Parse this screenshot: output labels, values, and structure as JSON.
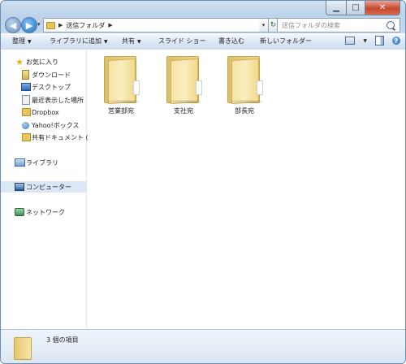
{
  "window": {
    "controls": {
      "minimize": "▁",
      "maximize": "□",
      "close": "✕"
    }
  },
  "nav": {
    "back_icon": "◀",
    "forward_icon": "▶",
    "dropdown_icon": "▾",
    "breadcrumb": [
      "送信フォルダ"
    ],
    "address_dropdown": "▾",
    "refresh_icon": "↻",
    "search_placeholder": "送信フォルダの検索"
  },
  "toolbar": {
    "items": [
      {
        "label": "整理",
        "caret": "▼"
      },
      {
        "label": "ライブラリに追加",
        "caret": "▼"
      },
      {
        "label": "共有",
        "caret": "▼"
      },
      {
        "label": "スライド ショー",
        "caret": ""
      },
      {
        "label": "書き込む",
        "caret": ""
      },
      {
        "label": "新しいフォルダー",
        "caret": ""
      }
    ],
    "view_caret": "▼",
    "help_icon": "?"
  },
  "sidebar": {
    "favorites": {
      "label": "お気に入り",
      "items": [
        {
          "label": "ダウンロード",
          "icon": "download-icon"
        },
        {
          "label": "デスクトップ",
          "icon": "desktop-icon"
        },
        {
          "label": "最近表示した場所",
          "icon": "recent-places-icon"
        },
        {
          "label": "Dropbox",
          "icon": "folder-icon"
        },
        {
          "label": "Yahoo!ボックス",
          "icon": "yahoo-box-icon"
        },
        {
          "label": "共有ドキュメント (",
          "icon": "shared-folder-icon"
        }
      ]
    },
    "library": {
      "label": "ライブラリ"
    },
    "computer": {
      "label": "コンピューター"
    },
    "network": {
      "label": "ネットワーク"
    }
  },
  "files": [
    {
      "name": "営業部宛"
    },
    {
      "name": "支社宛"
    },
    {
      "name": "部長宛"
    }
  ],
  "status": {
    "text": "3 個の項目"
  },
  "colors": {
    "chrome": "#c6d9ed",
    "selected_nav": "#dbe7f5",
    "folder": "#f6e3a3"
  }
}
